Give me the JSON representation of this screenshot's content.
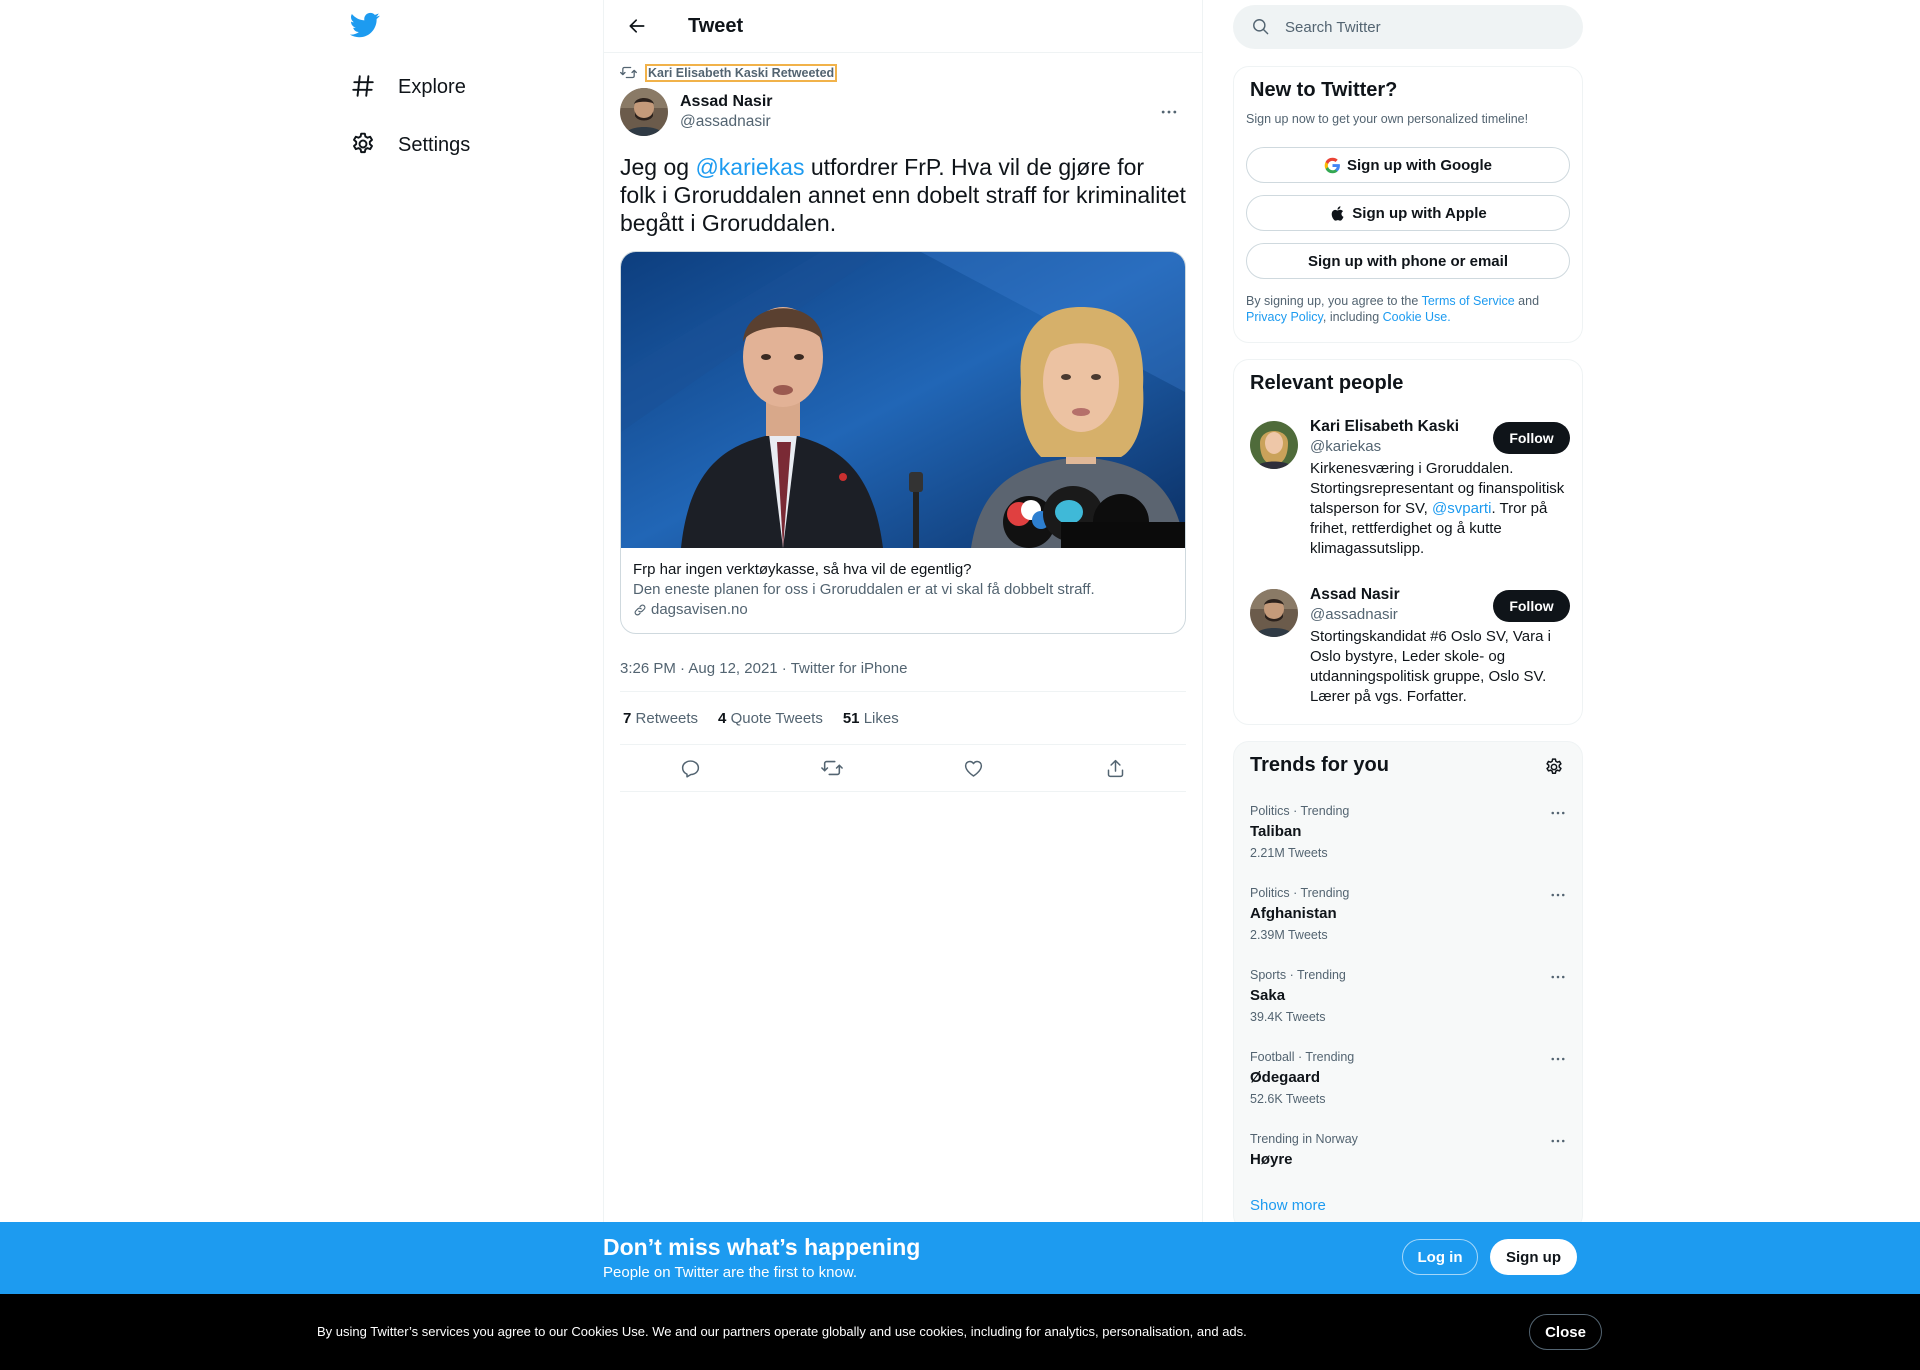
{
  "nav": {
    "logo_icon": "twitter-bird-icon",
    "items": [
      {
        "label": "Explore",
        "icon": "hashtag-icon"
      },
      {
        "label": "Settings",
        "icon": "gear-icon"
      }
    ]
  },
  "main": {
    "header_title": "Tweet",
    "retweeted_by": "Kari Elisabeth Kaski Retweeted",
    "author": {
      "name": "Assad Nasir",
      "handle": "@assadnasir"
    },
    "text": {
      "before": "Jeg og ",
      "mention": "@kariekas",
      "after": " utfordrer FrP. Hva vil de gjøre for folk i Groruddalen annet enn dobelt straff for kriminalitet begått i Groruddalen."
    },
    "card": {
      "title": "Frp har ingen verktøykasse, så hva vil de egentlig?",
      "description": "Den eneste planen for oss i Groruddalen er at vi skal få dobbelt straff.",
      "domain": "dagsavisen.no"
    },
    "meta": {
      "time": "3:26 PM",
      "separator": " · ",
      "date": "Aug 12, 2021",
      "source": "Twitter for iPhone"
    },
    "stats": [
      {
        "count": "7",
        "label": "Retweets"
      },
      {
        "count": "4",
        "label": "Quote Tweets"
      },
      {
        "count": "51",
        "label": "Likes"
      }
    ]
  },
  "search": {
    "placeholder": "Search Twitter"
  },
  "new_to_twitter": {
    "title": "New to Twitter?",
    "subtitle": "Sign up now to get your own personalized timeline!",
    "google": "Sign up with Google",
    "apple": "Sign up with Apple",
    "phone": "Sign up with phone or email",
    "legal_1": "By signing up, you agree to the ",
    "terms": "Terms of Service",
    "legal_2": " and ",
    "privacy": "Privacy Policy",
    "legal_3": ", including ",
    "cookie": "Cookie Use."
  },
  "relevant_people": {
    "title": "Relevant people",
    "people": [
      {
        "name": "Kari Elisabeth Kaski",
        "handle": "@kariekas",
        "bio_1": "Kirkenesværing i Groruddalen. Stortingsrepresentant og finanspolitisk talsperson for SV, ",
        "bio_mention": "@svparti",
        "bio_2": ". Tror på frihet, rettferdighet og å kutte klimagassutslipp.",
        "follow": "Follow"
      },
      {
        "name": "Assad Nasir",
        "handle": "@assadnasir",
        "bio_1": "Stortingskandidat #6 Oslo SV, Vara i Oslo bystyre, Leder skole- og utdanningspolitisk gruppe, Oslo SV. Lærer på vgs. Forfatter.",
        "follow": "Follow"
      }
    ]
  },
  "trends": {
    "title": "Trends for you",
    "items": [
      {
        "meta": "Politics · Trending",
        "name": "Taliban",
        "count": "2.21M Tweets"
      },
      {
        "meta": "Politics · Trending",
        "name": "Afghanistan",
        "count": "2.39M Tweets"
      },
      {
        "meta": "Sports · Trending",
        "name": "Saka",
        "count": "39.4K Tweets"
      },
      {
        "meta": "Football · Trending",
        "name": "Ødegaard",
        "count": "52.6K Tweets"
      },
      {
        "meta": "Trending in Norway",
        "name": "Høyre",
        "count": ""
      }
    ],
    "show_more": "Show more"
  },
  "banner": {
    "title": "Don’t miss what’s happening",
    "subtitle": "People on Twitter are the first to know.",
    "login": "Log in",
    "signup": "Sign up"
  },
  "cookie_bar": {
    "text": "By using Twitter’s services you agree to our Cookies Use. We and our partners operate globally and use cookies, including for analytics, personalisation, and ads.",
    "close": "Close"
  },
  "colors": {
    "accent": "#1d9bf0",
    "text": "#0f1419",
    "secondary": "#536471",
    "banner": "#1d9bf0",
    "cookie_bg": "#000000"
  }
}
